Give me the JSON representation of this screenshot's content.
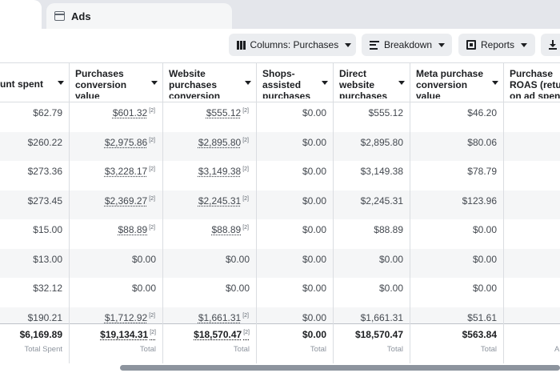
{
  "tabs": {
    "ads_label": "Ads"
  },
  "toolbar": {
    "columns_label": "Columns: Purchases",
    "breakdown_label": "Breakdown",
    "reports_label": "Reports"
  },
  "columns": [
    "unt spent",
    "Purchases conversion value",
    "Website purchases conversion value",
    "Shops-assisted purchases",
    "Direct website purchases",
    "Meta purchase conversion value",
    "Purchase ROAS (return on ad spend)"
  ],
  "rows": [
    [
      "$62.79",
      "$601.32",
      "$555.12",
      "$0.00",
      "$555.12",
      "$46.20"
    ],
    [
      "$260.22",
      "$2,975.86",
      "$2,895.80",
      "$0.00",
      "$2,895.80",
      "$80.06"
    ],
    [
      "$273.36",
      "$3,228.17",
      "$3,149.38",
      "$0.00",
      "$3,149.38",
      "$78.79"
    ],
    [
      "$273.45",
      "$2,369.27",
      "$2,245.31",
      "$0.00",
      "$2,245.31",
      "$123.96"
    ],
    [
      "$15.00",
      "$88.89",
      "$88.89",
      "$0.00",
      "$88.89",
      "$0.00"
    ],
    [
      "$13.00",
      "$0.00",
      "$0.00",
      "$0.00",
      "$0.00",
      "$0.00"
    ],
    [
      "$32.12",
      "$0.00",
      "$0.00",
      "$0.00",
      "$0.00",
      "$0.00"
    ],
    [
      "$190.21",
      "$1,712.92",
      "$1,661.31",
      "$0.00",
      "$1,661.31",
      "$51.61"
    ]
  ],
  "footnote_mark": "[2]",
  "totals": {
    "values": [
      "$6,169.89",
      "$19,134.31",
      "$18,570.47",
      "$0.00",
      "$18,570.47",
      "$563.84"
    ],
    "labels": [
      "Total Spent",
      "Total",
      "Total",
      "Total",
      "Total",
      "Total",
      "A"
    ]
  }
}
